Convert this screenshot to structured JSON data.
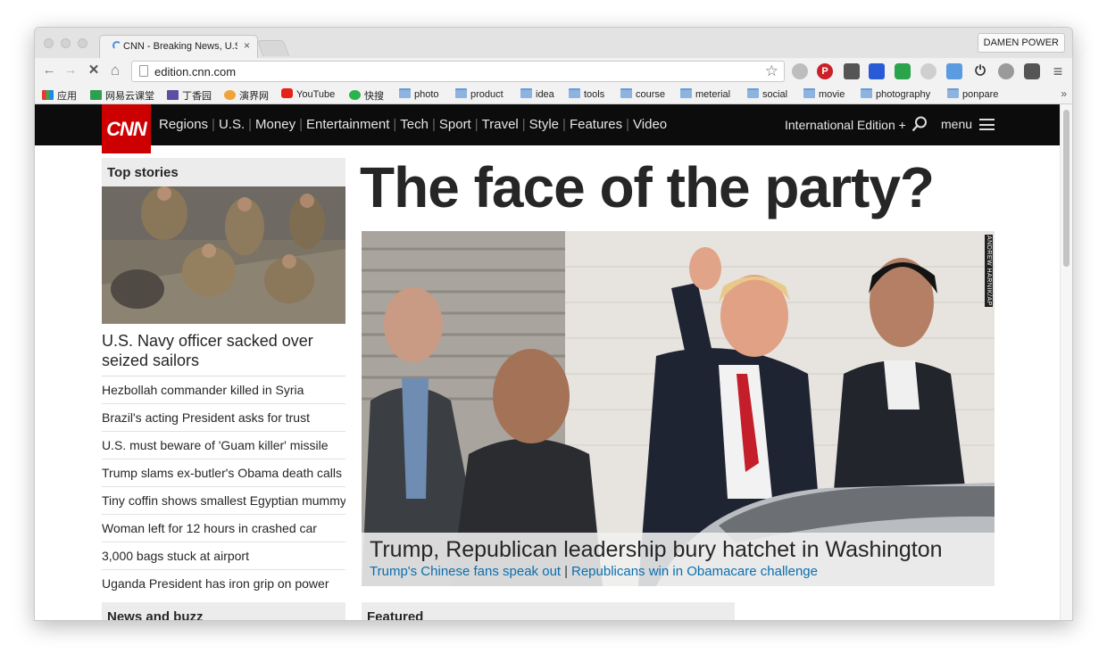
{
  "browser": {
    "tab_title": "CNN - Breaking News, U.S.",
    "tab_close": "×",
    "profile_name": "DAMEN POWER",
    "url": "edition.cnn.com",
    "back": "←",
    "forward": "→",
    "stop": "✕",
    "home": "⌂",
    "star": "☆",
    "menu": "≡",
    "bookmarks": [
      "应用",
      "网易云课堂",
      "丁香园",
      "演界网",
      "YouTube",
      "快搜",
      "photo",
      "product",
      "idea",
      "tools",
      "course",
      "meterial",
      "social",
      "movie",
      "photography",
      "ponpare"
    ],
    "bookmarks_more": "»",
    "icons": [
      "reload-stop-icon",
      "home-icon",
      "star-icon",
      "pinterest-icon",
      "shield-icon",
      "paw-icon",
      "adblock-icon",
      "power-icon",
      "evernote-icon",
      "chrome-menu-icon"
    ]
  },
  "cnn": {
    "logo": "CNN",
    "nav": [
      "Regions",
      "U.S.",
      "Money",
      "Entertainment",
      "Tech",
      "Sport",
      "Travel",
      "Style",
      "Features",
      "Video"
    ],
    "edition": "International Edition +",
    "menu": "menu",
    "brand_color": "#cc0000",
    "link_color": "#0a6fad"
  },
  "top_stories": {
    "heading": "Top stories",
    "lead": "U.S. Navy officer sacked over seized sailors",
    "items": [
      "Hezbollah commander killed in Syria",
      "Brazil's acting President asks for trust",
      "U.S. must beware of 'Guam killer' missile",
      "Trump slams ex-butler's Obama death calls",
      "Tiny coffin shows smallest Egyptian mummy",
      "Woman left for 12 hours in crashed car",
      "3,000 bags stuck at airport",
      "Uganda President has iron grip on power"
    ]
  },
  "hero": {
    "title": "The face of the party?",
    "caption": "Trump, Republican leadership bury hatchet in Washington",
    "links": [
      "Trump's Chinese fans speak out",
      "Republicans win in Obamacare challenge"
    ],
    "link_separator": "|",
    "credit": "ANDREW HARNIK/AP"
  },
  "sections": {
    "news_and_buzz": "News and buzz",
    "featured": "Featured"
  }
}
